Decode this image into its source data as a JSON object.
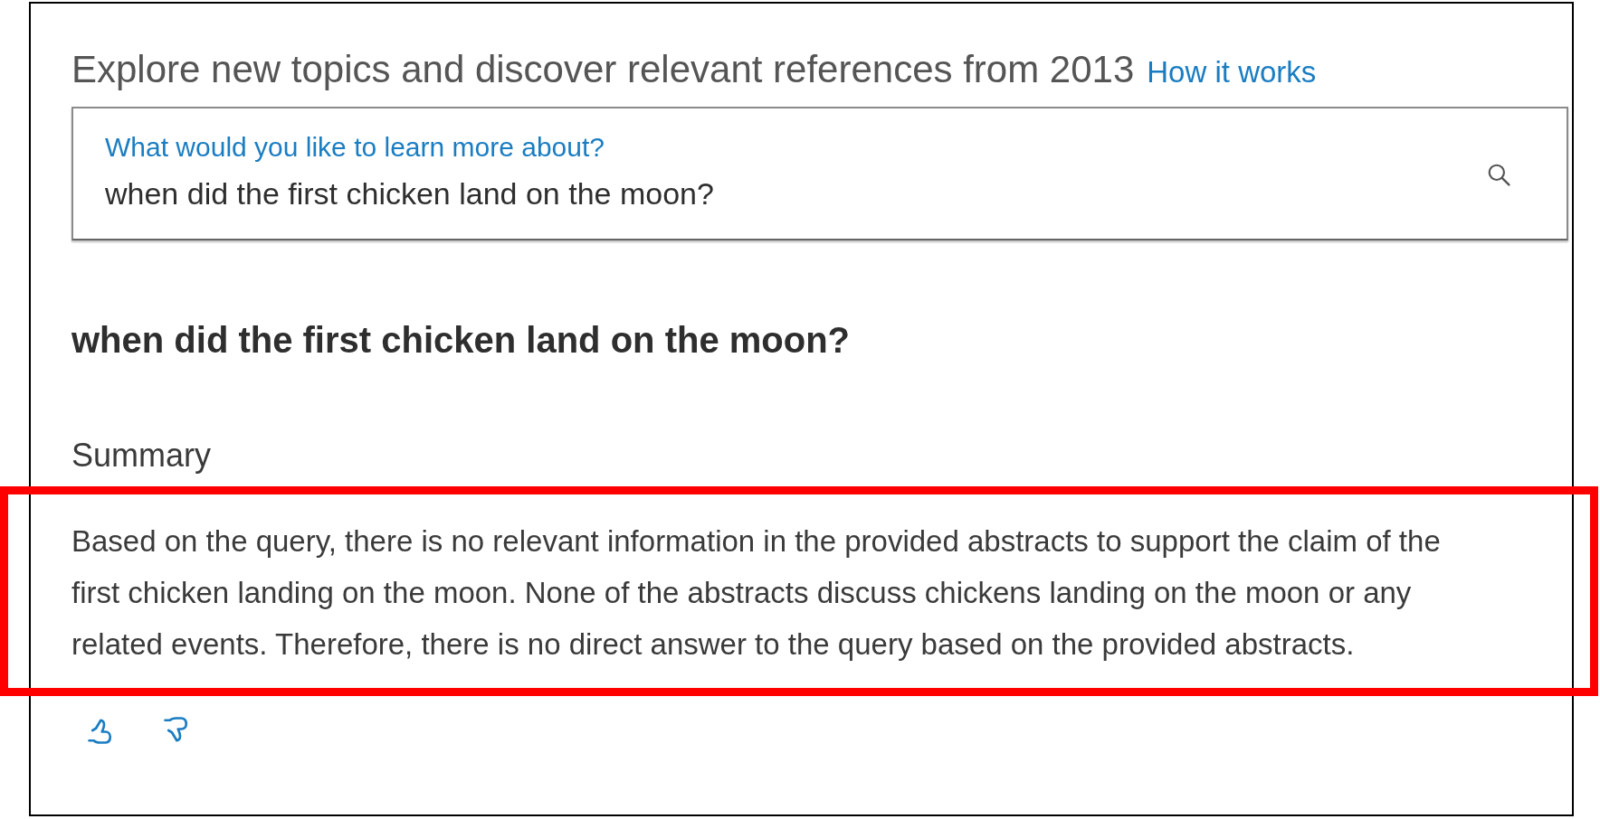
{
  "header": {
    "title": "Explore new topics and discover relevant references from 2013",
    "help_link": "How it works"
  },
  "search": {
    "label": "What would you like to learn more about?",
    "value": "when did the first chicken land on the moon?"
  },
  "query_heading": "when did the first chicken land on the moon?",
  "summary": {
    "heading": "Summary",
    "text": "Based on the query, there is no relevant information in the provided abstracts to support the claim of the first chicken landing on the moon. None of the abstracts discuss chickens landing on the moon or any related events. Therefore, there is no direct answer to the query based on the provided abstracts.",
    "highlighted": true
  },
  "feedback": [
    {
      "kind": "thumbs_up"
    },
    {
      "kind": "thumbs_down"
    }
  ]
}
